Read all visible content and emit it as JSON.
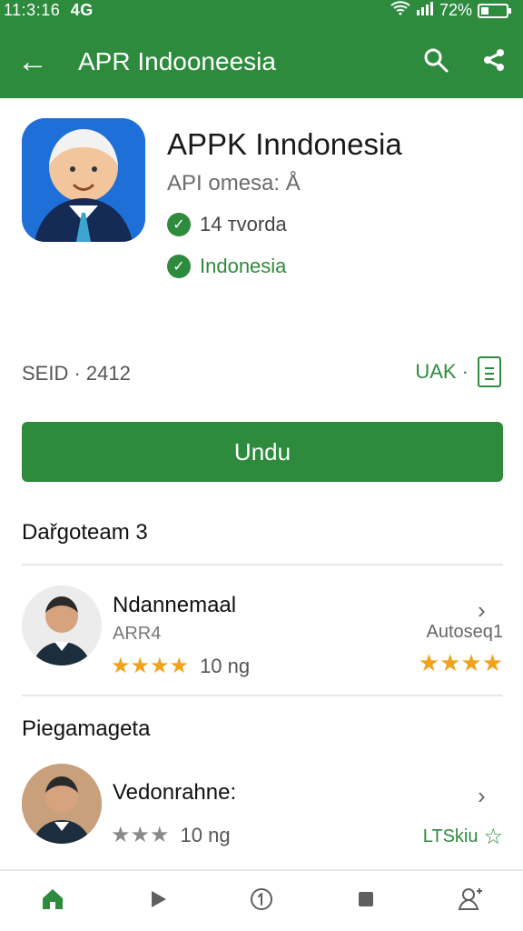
{
  "status_bar": {
    "time": "11:3:16",
    "network": "4G",
    "battery": "72%"
  },
  "appbar": {
    "title": "APR Indooneesia"
  },
  "app": {
    "name": "APPK Inndonesia",
    "meta": "API omesa: Å",
    "downloads": "14 тvorda",
    "region": "Indonesia"
  },
  "info_row": {
    "left": "SEID · 2412",
    "right": "UAK ·"
  },
  "install_button": {
    "label": "Undu"
  },
  "sections": {
    "reviews_title": "Dařgoteam 3",
    "related_title": "Piegamageta"
  },
  "reviews": [
    {
      "name": "Ndannemaal",
      "sub": "ARR4",
      "stars_text": "★★★★",
      "rating": "10 ng",
      "right_label": "Autoseq1",
      "right_stars": "★★★★"
    }
  ],
  "related": [
    {
      "name": "Vedonrahne:",
      "stars_text": "★★★",
      "rating": "10 ng",
      "right_label": "LTSkiu"
    }
  ],
  "nav": {
    "home": "home-icon",
    "play": "play-icon",
    "one": "numbered-circle-icon",
    "square": "square-icon",
    "account": "account-icon"
  }
}
